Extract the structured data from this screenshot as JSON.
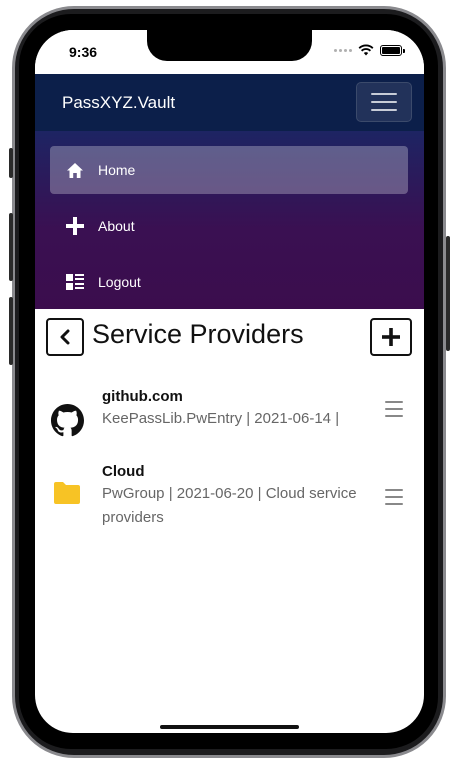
{
  "status_bar": {
    "time": "9:36"
  },
  "app": {
    "title": "PassXYZ.Vault"
  },
  "nav": {
    "items": [
      {
        "label": "Home",
        "icon": "home-icon",
        "active": true
      },
      {
        "label": "About",
        "icon": "plus-icon",
        "active": false
      },
      {
        "label": "Logout",
        "icon": "list-icon",
        "active": false
      }
    ]
  },
  "page": {
    "title": "Service Providers"
  },
  "items": [
    {
      "title": "github.com",
      "description": "KeePassLib.PwEntry | 2021-06-14 |",
      "icon": "github-icon"
    },
    {
      "title": "Cloud",
      "description": "PwGroup | 2021-06-20 | Cloud service providers",
      "icon": "folder-icon"
    }
  ],
  "colors": {
    "header_bg": "#0c1f4a",
    "nav_gradient_top": "#1d2463",
    "nav_gradient_bottom": "#3b0d4d",
    "folder": "#f7c325"
  }
}
